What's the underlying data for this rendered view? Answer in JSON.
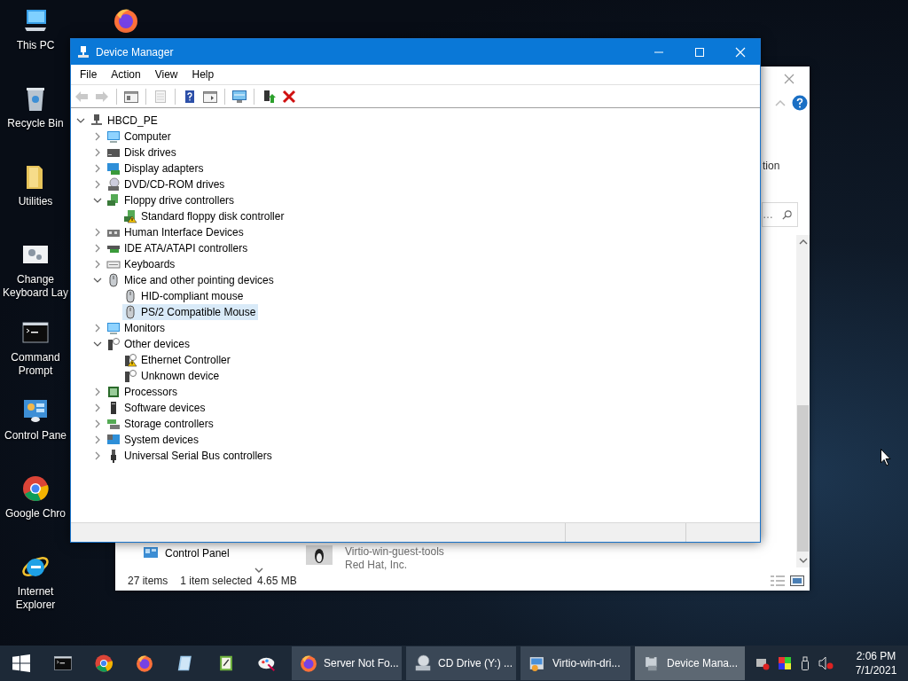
{
  "desktop": {
    "columns": [
      [
        {
          "kind": "pc",
          "label": "This PC"
        },
        {
          "kind": "bin",
          "label": "Recycle Bin"
        },
        {
          "kind": "folder",
          "label": "Utilities"
        },
        {
          "kind": "keyboard",
          "label": "Change Keyboard Lay"
        },
        {
          "kind": "cmd",
          "label": "Command Prompt"
        },
        {
          "kind": "control",
          "label": "Control Pane"
        },
        {
          "kind": "chrome",
          "label": "Google Chro"
        },
        {
          "kind": "ie",
          "label": "Internet Explorer"
        }
      ],
      [
        {
          "kind": "firefox"
        }
      ]
    ]
  },
  "explorer": {
    "partial_label": "tion",
    "search_placeholder": "…",
    "nav_items": [
      "Control Panel"
    ],
    "items": [
      {
        "name": "Virtio-win-guest-tools",
        "publisher": "Red Hat, Inc."
      }
    ],
    "status": [
      "27 items",
      "1 item selected",
      "4.65 MB"
    ]
  },
  "device_manager": {
    "title": "Device Manager",
    "menu": [
      "File",
      "Action",
      "View",
      "Help"
    ],
    "toolbar": [
      {
        "kind": "back",
        "disabled": true
      },
      {
        "kind": "forward",
        "disabled": true
      },
      {
        "kind": "sep"
      },
      {
        "kind": "tree",
        "disabled": false
      },
      {
        "kind": "sep"
      },
      {
        "kind": "properties",
        "disabled": true
      },
      {
        "kind": "sep"
      },
      {
        "kind": "help",
        "disabled": false
      },
      {
        "kind": "pane",
        "disabled": false
      },
      {
        "kind": "sep"
      },
      {
        "kind": "scan",
        "disabled": false
      },
      {
        "kind": "sep"
      },
      {
        "kind": "update",
        "disabled": false
      },
      {
        "kind": "uninstall",
        "disabled": false
      }
    ],
    "tree": {
      "label": "HBCD_PE",
      "kind": "root",
      "expanded": true,
      "selected": false,
      "children": [
        {
          "label": "Computer",
          "kind": "computer",
          "expanded": false,
          "selected": false
        },
        {
          "label": "Disk drives",
          "kind": "disk",
          "expanded": false,
          "selected": false
        },
        {
          "label": "Display adapters",
          "kind": "display",
          "expanded": false,
          "selected": false
        },
        {
          "label": "DVD/CD-ROM drives",
          "kind": "dvd",
          "expanded": false,
          "selected": false
        },
        {
          "label": "Floppy drive controllers",
          "kind": "floppy",
          "expanded": true,
          "selected": false,
          "children": [
            {
              "label": "Standard floppy disk controller",
              "kind": "floppy",
              "warning": true,
              "selected": false
            }
          ]
        },
        {
          "label": "Human Interface Devices",
          "kind": "hid",
          "expanded": false,
          "selected": false
        },
        {
          "label": "IDE ATA/ATAPI controllers",
          "kind": "ide",
          "expanded": false,
          "selected": false
        },
        {
          "label": "Keyboards",
          "kind": "keyboard",
          "expanded": false,
          "selected": false
        },
        {
          "label": "Mice and other pointing devices",
          "kind": "mouse",
          "expanded": true,
          "selected": false,
          "children": [
            {
              "label": "HID-compliant mouse",
              "kind": "mouse",
              "warning": false,
              "selected": false
            },
            {
              "label": "PS/2 Compatible Mouse",
              "kind": "mouse",
              "warning": false,
              "selected": true
            }
          ]
        },
        {
          "label": "Monitors",
          "kind": "monitor",
          "expanded": false,
          "selected": false
        },
        {
          "label": "Other devices",
          "kind": "unknown",
          "expanded": true,
          "selected": false,
          "children": [
            {
              "label": "Ethernet Controller",
              "kind": "unknown",
              "warning": true,
              "selected": false
            },
            {
              "label": "Unknown device",
              "kind": "unknown",
              "warning": false,
              "selected": false
            }
          ]
        },
        {
          "label": "Processors",
          "kind": "processor",
          "expanded": false,
          "selected": false
        },
        {
          "label": "Software devices",
          "kind": "software",
          "expanded": false,
          "selected": false
        },
        {
          "label": "Storage controllers",
          "kind": "storage",
          "expanded": false,
          "selected": false
        },
        {
          "label": "System devices",
          "kind": "system",
          "expanded": false,
          "selected": false
        },
        {
          "label": "Universal Serial Bus controllers",
          "kind": "usb",
          "expanded": false,
          "selected": false
        }
      ]
    }
  },
  "taskbar": {
    "pinned": [
      {
        "kind": "cmd"
      },
      {
        "kind": "chrome"
      },
      {
        "kind": "firefox"
      },
      {
        "kind": "notes"
      },
      {
        "kind": "notepad"
      },
      {
        "kind": "paint"
      }
    ],
    "windows": [
      {
        "kind": "firefox",
        "label": "Server Not Fo...",
        "selected": false
      },
      {
        "kind": "drive",
        "label": "CD Drive (Y:) ...",
        "selected": false
      },
      {
        "kind": "installer",
        "label": "Virtio-win-dri...",
        "selected": false
      },
      {
        "kind": "devmgr",
        "label": "Device Mana...",
        "selected": true
      }
    ],
    "time": "2:06 PM",
    "date": "7/1/2021"
  }
}
